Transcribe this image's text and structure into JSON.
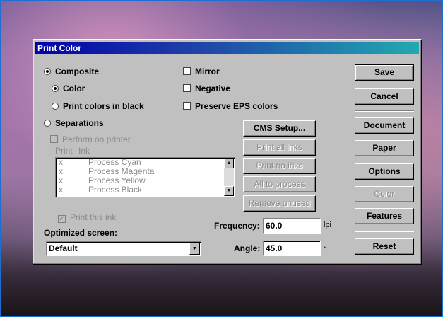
{
  "dialog": {
    "title": "Print Color"
  },
  "options": {
    "composite": "Composite",
    "color": "Color",
    "print_colors_black": "Print colors in black",
    "separations": "Separations",
    "perform_on_printer": "Perform on printer",
    "mirror": "Mirror",
    "negative": "Negative",
    "preserve_eps": "Preserve EPS colors"
  },
  "ink_list": {
    "col_print": "Print",
    "col_ink": "Ink",
    "rows": [
      {
        "mark": "x",
        "name": "Process Cyan"
      },
      {
        "mark": "x",
        "name": "Process Magenta"
      },
      {
        "mark": "x",
        "name": "Process Yellow"
      },
      {
        "mark": "x",
        "name": "Process Black"
      }
    ]
  },
  "buttons": {
    "cms_setup": "CMS Setup...",
    "print_all_inks": "Print all inks",
    "print_no_inks": "Print no inks",
    "all_to_process": "All to process",
    "remove_unused": "Remove unused",
    "save": "Save",
    "cancel": "Cancel",
    "document": "Document",
    "paper": "Paper",
    "options": "Options",
    "color": "Color",
    "features": "Features",
    "reset": "Reset"
  },
  "print_this_ink": "Print this ink",
  "optimized_screen": {
    "label": "Optimized screen:",
    "value": "Default"
  },
  "frequency": {
    "label": "Frequency:",
    "value": "60.0",
    "unit": "lpi"
  },
  "angle": {
    "label": "Angle:",
    "value": "45.0",
    "unit": "°"
  }
}
